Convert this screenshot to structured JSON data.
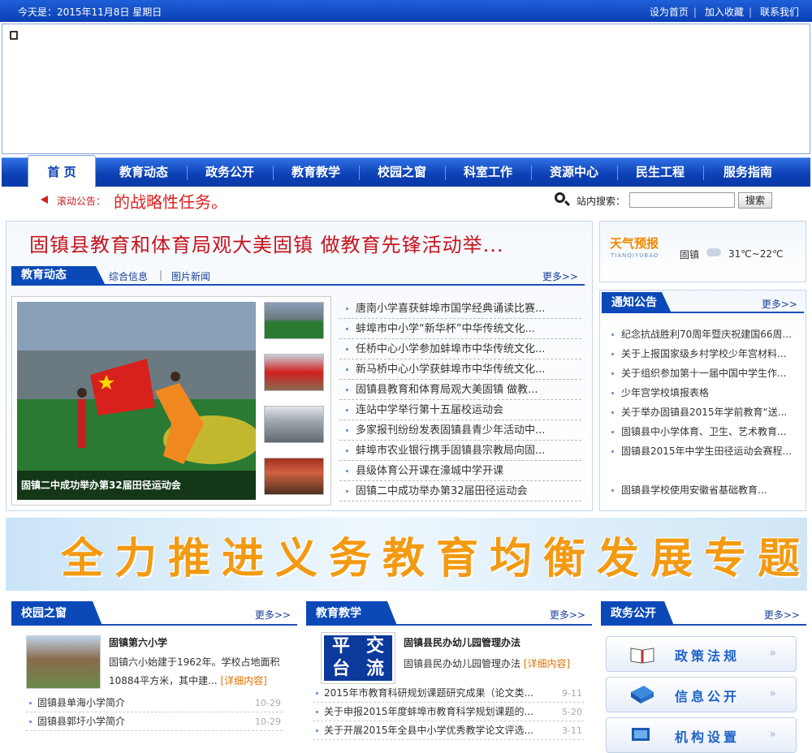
{
  "topbar": {
    "date": "今天是：2015年11月8日  星期日",
    "links": [
      "设为首页",
      "加入收藏",
      "联系我们"
    ]
  },
  "nav": {
    "items": [
      "首 页",
      "教育动态",
      "政务公开",
      "教育教学",
      "校园之窗",
      "科室工作",
      "资源中心",
      "民生工程",
      "服务指南"
    ]
  },
  "notice_bar": {
    "label": "滚动公告：",
    "text": "的战略性任务。",
    "search_label": "站内搜索：",
    "search_button": "搜索"
  },
  "headline": "固镇县教育和体育局观大美固镇  做教育先锋活动举...",
  "edu_news": {
    "title": "教育动态",
    "subtabs": [
      "综合信息",
      "图片新闻"
    ],
    "sep": "|",
    "more": "更多>>",
    "slide_caption": "固镇二中成功举办第32届田径运动会",
    "items": [
      "唐南小学喜获蚌埠市国学经典诵读比赛...",
      "蚌埠市中小学“新华杯”中华传统文化...",
      "任桥中心小学参加蚌埠市中华传统文化...",
      "新马桥中心小学获蚌埠市中华传统文化...",
      "固镇县教育和体育局观大美固镇  做教...",
      "连站中学举行第十五届校运动会",
      "多家报刊纷纷发表固镇县青少年活动中...",
      "蚌埠市农业银行携手固镇县宗教局向固...",
      "县级体育公开课在濠城中学开课",
      "固镇二中成功举办第32届田径运动会"
    ]
  },
  "weather": {
    "title": "天气预报",
    "sub": "TIANQIYUBAO",
    "city": "固镇",
    "temp": "31℃~22℃"
  },
  "notice": {
    "title": "通知公告",
    "more": "更多>>",
    "items": [
      "纪念抗战胜利70周年暨庆祝建国66周...",
      "关于上报国家级乡村学校少年宫材料...",
      "关于组织参加第十一届中国中学生作...",
      "少年宫学校填报表格",
      "关于举办固镇县2015年学前教育“送...",
      "固镇县中小学体育、卫生、艺术教育...",
      "固镇县2015年中学生田径运动会赛程...",
      "固镇县学校使用安徽省基础教育..."
    ]
  },
  "banner": "全力推进义务教育均衡发展专题",
  "campus": {
    "title": "校园之窗",
    "more": "更多>>",
    "feat_title": "固镇第六小学",
    "feat_text": "固镇六小始建于1962年。学校占地面积10884平方米，其中建...",
    "detail": "[详细内容]",
    "items": [
      {
        "t": "固镇县单海小学简介",
        "d": "10-29"
      },
      {
        "t": "固镇县郭圩小学简介",
        "d": "10-29"
      }
    ]
  },
  "teaching": {
    "title": "教育教学",
    "more": "更多>>",
    "logo": [
      "平",
      "交",
      "台",
      "流"
    ],
    "feat_title": "固镇县民办幼儿园管理办法",
    "feat_text": "固镇县民办幼儿园管理办法",
    "detail": "[详细内容]",
    "items": [
      {
        "t": "2015年市教育科研规划课题研究成果（论文类...",
        "d": "9-11"
      },
      {
        "t": "关于申报2015年度蚌埠市教育科学规划课题的...",
        "d": "5-20"
      },
      {
        "t": "关于开展2015年全县中小学优秀教学论文评选...",
        "d": "3-11"
      }
    ]
  },
  "gov": {
    "title": "政务公开",
    "more": "更多>>",
    "services": [
      "政策法规",
      "信息公开",
      "机构设置"
    ]
  },
  "colors": {
    "brand": "#0b49b8",
    "headline": "#c8141e",
    "banner": "#f39a12"
  }
}
